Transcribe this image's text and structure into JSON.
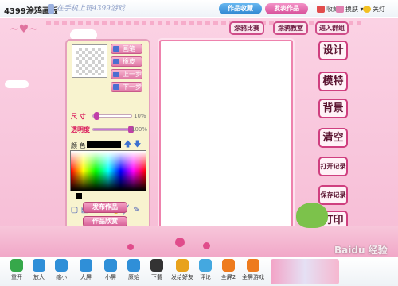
{
  "topbar": {
    "app_title": "4399涂鸦画板",
    "slogan": "在手机上玩4399游戏",
    "btn_blue": "作品收藏",
    "btn_pink": "发表作品",
    "fav": "收藏",
    "skin": "换肤",
    "lights_off": "关灯"
  },
  "canvas_area": {
    "deco": "~♥~",
    "tabs": {
      "contest": "涂鸦比赛",
      "classroom": "涂鸦教室",
      "group": "进入群组"
    },
    "tools": [
      "画笔",
      "橡皮",
      "上一步",
      "下一步"
    ],
    "size_label": "尺 寸",
    "size_value": "10%",
    "alpha_label": "透明度",
    "alpha_value": "100%",
    "size_level": 0.1,
    "alpha_level": 1.0,
    "color_label": "颜 色",
    "current_color": "#000000",
    "publish": "发布作品",
    "gallery": "作品欣赏",
    "side": [
      "设计",
      "模特",
      "背景",
      "清空",
      "打开记录",
      "保存记录",
      "打印"
    ]
  },
  "bottombar": {
    "items": [
      {
        "label": "重开",
        "icon": "refresh-icon",
        "color": "#36a84a"
      },
      {
        "label": "放大",
        "icon": "zoom-in-icon",
        "color": "#2f8fd8"
      },
      {
        "label": "缩小",
        "icon": "zoom-out-icon",
        "color": "#2f8fd8"
      },
      {
        "label": "大屏",
        "icon": "large-screen-icon",
        "color": "#2f8fd8"
      },
      {
        "label": "小屏",
        "icon": "small-screen-icon",
        "color": "#2f8fd8"
      },
      {
        "label": "原始",
        "icon": "original-size-icon",
        "color": "#2f8fd8"
      },
      {
        "label": "下载",
        "icon": "phone-download-icon",
        "color": "#333333"
      },
      {
        "label": "发给好友",
        "icon": "send-friend-icon",
        "color": "#e8a21c"
      },
      {
        "label": "评论",
        "icon": "comment-icon",
        "color": "#44a8e0"
      },
      {
        "label": "全屏2",
        "icon": "fullscreen2-icon",
        "color": "#ee7b1e"
      },
      {
        "label": "全屏游戏",
        "icon": "fullscreen-game-icon",
        "color": "#ee7b1e"
      }
    ],
    "watermark": "Baidu 经验"
  }
}
